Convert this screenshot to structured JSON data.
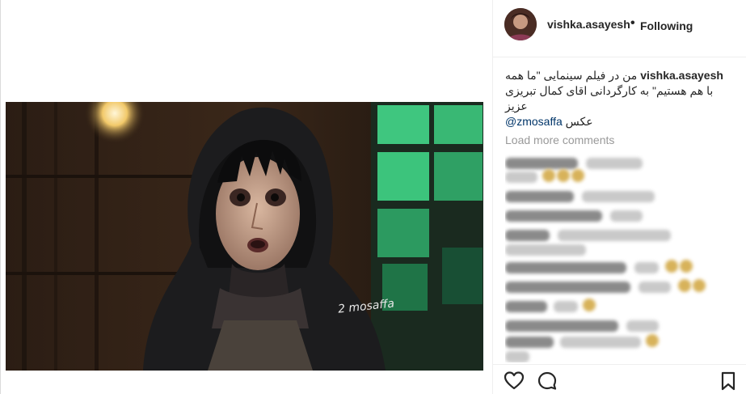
{
  "post": {
    "username": "vishka.asayesh",
    "separator": "•",
    "follow_status": "Following",
    "watermark": "2 mosaffa",
    "caption": {
      "username": "vishka.asayesh",
      "line1": "من در فیلم سینمایی \"ما همه",
      "line2": "با هم هستیم\" به کارگردانی اقای کمال تبریزی",
      "line3": "عزیز",
      "line4_prefix": "عکس",
      "mention": "@zmosaffa"
    },
    "load_more": "Load more comments"
  },
  "icons": {
    "like": "heart-icon",
    "comment": "comment-icon",
    "save": "bookmark-icon"
  },
  "colors": {
    "text": "#262626",
    "muted": "#999999",
    "link": "#003569",
    "border": "#efefef"
  }
}
